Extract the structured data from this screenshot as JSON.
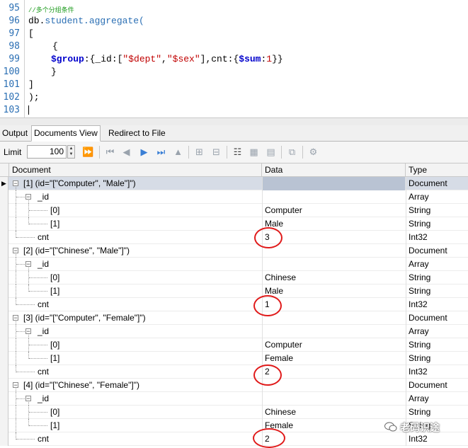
{
  "editor": {
    "line_numbers": [
      "95",
      "96",
      "97",
      "98",
      "99",
      "100",
      "101",
      "102",
      "103"
    ],
    "comment": "//多个分组条件",
    "db": "db.",
    "collection": "student",
    "method": ".aggregate(",
    "open_bracket": "[",
    "open_brace": "{",
    "group_op": "$group",
    "group_mid1": ":{_id:[",
    "dept_str": "\"$dept\"",
    "comma": ",",
    "sex_str": "\"$sex\"",
    "group_mid2": "],cnt:{",
    "sum_op": "$sum",
    "colon": ":",
    "sum_value": "1",
    "group_end": "}}",
    "close_brace": "}",
    "close_bracket": "]",
    "close_paren": ");"
  },
  "tabs": [
    {
      "label": "Output",
      "active": false
    },
    {
      "label": "Documents View",
      "active": true
    },
    {
      "label": "Redirect to File",
      "active": false
    }
  ],
  "toolbar": {
    "limit_label": "Limit",
    "limit_value": "100"
  },
  "grid": {
    "headers": {
      "document": "Document",
      "data": "Data",
      "type": "Type"
    },
    "rows": [
      {
        "doc": "[1] (id=\"[\"Computer\", \"Male\"]\")",
        "data": "",
        "type": "Document"
      },
      {
        "doc": "_id",
        "data": "",
        "type": "Array"
      },
      {
        "doc": "[0]",
        "data": "Computer",
        "type": "String"
      },
      {
        "doc": "[1]",
        "data": "Male",
        "type": "String"
      },
      {
        "doc": "cnt",
        "data": "3",
        "type": "Int32"
      },
      {
        "doc": "[2] (id=\"[\"Chinese\", \"Male\"]\")",
        "data": "",
        "type": "Document"
      },
      {
        "doc": "_id",
        "data": "",
        "type": "Array"
      },
      {
        "doc": "[0]",
        "data": "Chinese",
        "type": "String"
      },
      {
        "doc": "[1]",
        "data": "Male",
        "type": "String"
      },
      {
        "doc": "cnt",
        "data": "1",
        "type": "Int32"
      },
      {
        "doc": "[3] (id=\"[\"Computer\", \"Female\"]\")",
        "data": "",
        "type": "Document"
      },
      {
        "doc": "_id",
        "data": "",
        "type": "Array"
      },
      {
        "doc": "[0]",
        "data": "Computer",
        "type": "String"
      },
      {
        "doc": "[1]",
        "data": "Female",
        "type": "String"
      },
      {
        "doc": "cnt",
        "data": "2",
        "type": "Int32"
      },
      {
        "doc": "[4] (id=\"[\"Chinese\", \"Female\"]\")",
        "data": "",
        "type": "Document"
      },
      {
        "doc": "_id",
        "data": "",
        "type": "Array"
      },
      {
        "doc": "[0]",
        "data": "Chinese",
        "type": "String"
      },
      {
        "doc": "[1]",
        "data": "Female",
        "type": "String"
      },
      {
        "doc": "cnt",
        "data": "2",
        "type": "Int32"
      }
    ]
  },
  "watermark": "老码识途",
  "colors": {
    "annotation": "#e01a1a",
    "selected_row": "#d6dce6"
  }
}
